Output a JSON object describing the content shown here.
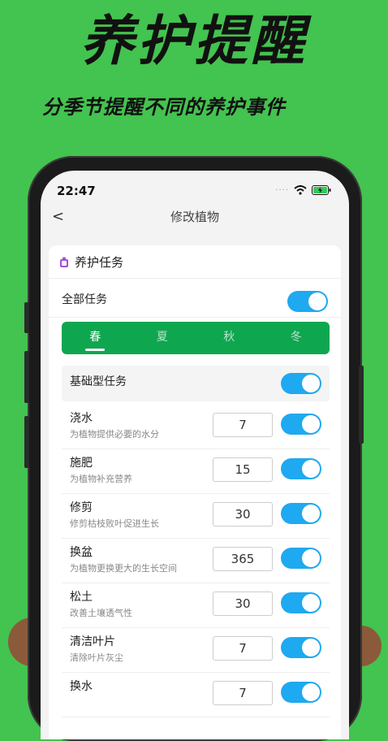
{
  "promo": {
    "headline": "养护提醒",
    "subline": "分季节提醒不同的养护事件"
  },
  "status_bar": {
    "time": "22:47",
    "signal_dots": "····",
    "wifi_icon": "wifi-icon",
    "battery_icon": "battery-charging-icon"
  },
  "nav": {
    "back_glyph": "<",
    "title": "修改植物"
  },
  "card": {
    "title": "养护任务",
    "icon": "bell-badge-icon",
    "all_tasks_label": "全部任务",
    "all_tasks_on": true
  },
  "seasons": {
    "tabs": [
      {
        "label": "春",
        "active": true
      },
      {
        "label": "夏",
        "active": false
      },
      {
        "label": "秋",
        "active": false
      },
      {
        "label": "冬",
        "active": false
      }
    ]
  },
  "group": {
    "label": "基础型任务",
    "on": true
  },
  "tasks": [
    {
      "name": "浇水",
      "desc": "为植物提供必要的水分",
      "days": "7",
      "on": true
    },
    {
      "name": "施肥",
      "desc": "为植物补充营养",
      "days": "15",
      "on": true
    },
    {
      "name": "修剪",
      "desc": "修剪枯枝败叶促进生长",
      "days": "30",
      "on": true
    },
    {
      "name": "换盆",
      "desc": "为植物更换更大的生长空间",
      "days": "365",
      "on": true
    },
    {
      "name": "松土",
      "desc": "改善土壤透气性",
      "days": "30",
      "on": true
    },
    {
      "name": "清洁叶片",
      "desc": "清除叶片灰尘",
      "days": "7",
      "on": true
    },
    {
      "name": "换水",
      "desc": "",
      "days": "7",
      "on": true
    }
  ],
  "colors": {
    "background": "#43c34f",
    "tab_bar": "#0fa650",
    "toggle_on": "#1ea9f0"
  }
}
